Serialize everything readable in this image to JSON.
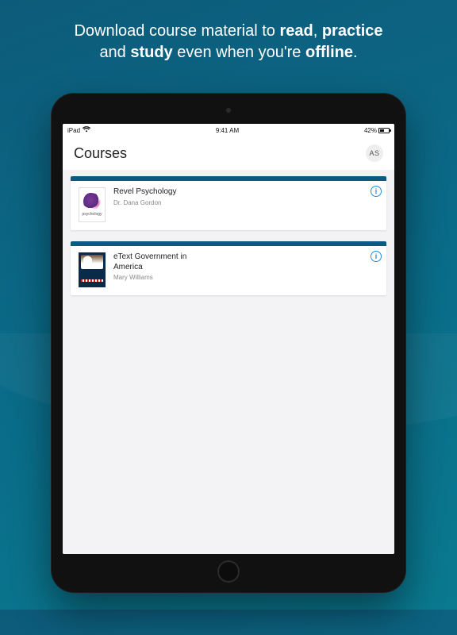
{
  "marketing": {
    "line1_pre": "Download course material to ",
    "line1_b1": "read",
    "line1_mid": ", ",
    "line1_b2": "practice",
    "line2_pre": "and ",
    "line2_b1": "study",
    "line2_post": " even when you're ",
    "line2_b2": "offline",
    "line2_end": "."
  },
  "statusbar": {
    "carrier": "iPad",
    "time": "9:41 AM",
    "battery_pct": "42%"
  },
  "appbar": {
    "title": "Courses",
    "avatar_initials": "AS"
  },
  "courses": [
    {
      "title": "Revel Psychology",
      "instructor": "Dr. Dana Gordon",
      "thumb_caption": "psychology",
      "thumb_kind": "psych"
    },
    {
      "title": "eText Government in America",
      "instructor": "Mary Williams",
      "thumb_caption": "",
      "thumb_kind": "gov"
    }
  ],
  "icons": {
    "info_glyph": "i"
  }
}
